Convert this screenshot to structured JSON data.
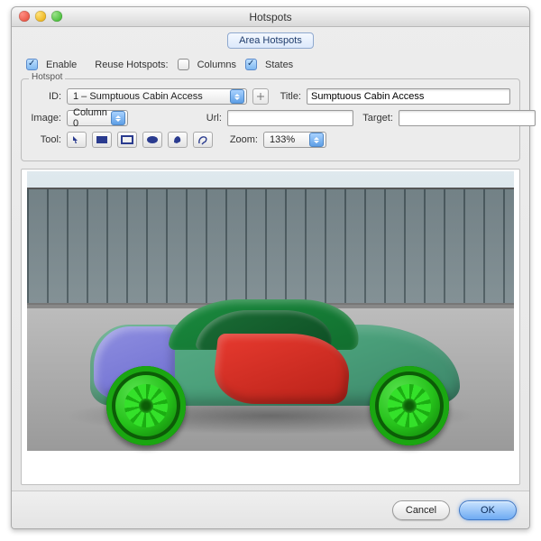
{
  "window": {
    "title": "Hotspots"
  },
  "tabs": {
    "area": "Area Hotspots"
  },
  "options": {
    "enable_label": "Enable",
    "reuse_label": "Reuse Hotspots:",
    "columns_label": "Columns",
    "states_label": "States",
    "enable_checked": true,
    "columns_checked": false,
    "states_checked": true
  },
  "group": {
    "label": "Hotspot",
    "id_label": "ID:",
    "id_value": "1 – Sumptuous Cabin Access",
    "title_label": "Title:",
    "title_value": "Sumptuous Cabin Access",
    "image_label": "Image:",
    "image_value": "Column 0",
    "url_label": "Url:",
    "url_value": "",
    "target_label": "Target:",
    "target_value": "",
    "tool_label": "Tool:",
    "zoom_label": "Zoom:",
    "zoom_value": "133%"
  },
  "footer": {
    "cancel": "Cancel",
    "ok": "OK"
  }
}
